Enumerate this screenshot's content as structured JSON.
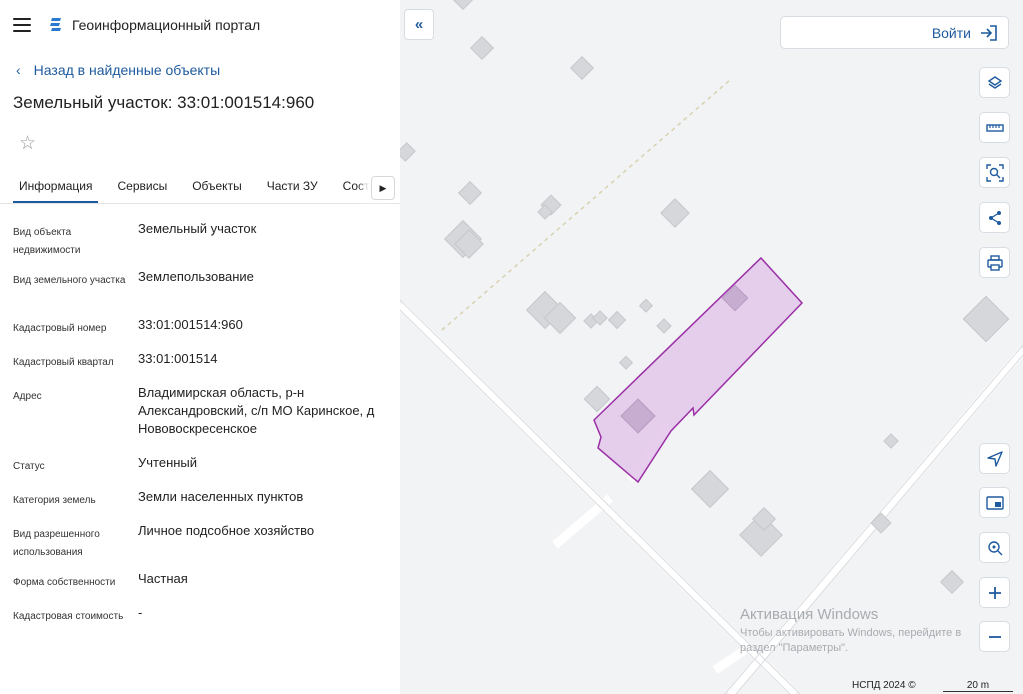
{
  "header": {
    "app_title": "Геоинформационный портал"
  },
  "nav": {
    "back_label": "Назад в найденные объекты"
  },
  "object": {
    "title": "Земельный участок: 33:01:001514:960"
  },
  "tabs": [
    {
      "label": "Информация",
      "active": true
    },
    {
      "label": "Сервисы"
    },
    {
      "label": "Объекты"
    },
    {
      "label": "Части ЗУ"
    },
    {
      "label": "Состав"
    }
  ],
  "properties": [
    {
      "label": "Вид объекта недвижимости",
      "value": "Земельный участок"
    },
    {
      "label": "Вид земельного участка",
      "value": "Землепользование"
    },
    {
      "label": "Кадастровый номер",
      "value": "33:01:001514:960"
    },
    {
      "label": "Кадастровый квартал",
      "value": "33:01:001514"
    },
    {
      "label": "Адрес",
      "value": "Владимирская область, р-н Александровский, с/п МО Каринское, д Нововоскресенское"
    },
    {
      "label": "Статус",
      "value": "Учтенный"
    },
    {
      "label": "Категория земель",
      "value": "Земли населенных пунктов"
    },
    {
      "label": "Вид разрешенного использования",
      "value": "Личное подсобное хозяйство"
    },
    {
      "label": "Форма собственности",
      "value": "Частная"
    },
    {
      "label": "Кадастровая стоимость",
      "value": "-"
    }
  ],
  "map": {
    "login_label": "Войти",
    "watermark_title": "Активация Windows",
    "watermark_line1": "Чтобы активировать Windows, перейдите в",
    "watermark_line2": "раздел \"Параметры\".",
    "credit": "НСПД 2024 ©",
    "scale_label": "20 m"
  },
  "colors": {
    "accent": "#1e5a9e",
    "parcel_fill": "#e3c6ea",
    "parcel_stroke": "#9b2fa6",
    "building": "#d4d6d9"
  }
}
